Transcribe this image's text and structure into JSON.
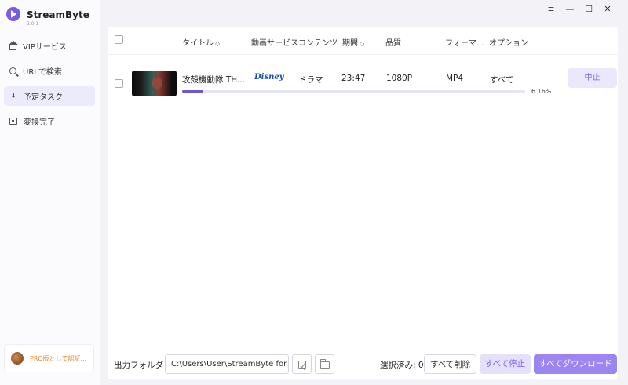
{
  "app": {
    "name": "StreamByte",
    "version": "2.0.1",
    "accent_color": "#7a5be6"
  },
  "sidebar": {
    "items": [
      {
        "label": "VIPサービス",
        "icon": "home-icon",
        "active": false
      },
      {
        "label": "URLで検索",
        "icon": "search-icon",
        "active": false
      },
      {
        "label": "予定タスク",
        "icon": "download-icon",
        "active": true
      },
      {
        "label": "変換完了",
        "icon": "archive-icon",
        "active": false
      }
    ],
    "pro_text": "PRO版として認証..."
  },
  "window_controls": {
    "menu": "≡",
    "minimize": "—",
    "maximize": "☐",
    "close": "✕"
  },
  "table": {
    "columns": {
      "title": "タイトル",
      "service": "動画サービス",
      "content": "コンテンツ",
      "duration": "期間",
      "quality": "品質",
      "format": "フォーマ...",
      "options": "オプション"
    },
    "rows": [
      {
        "title": "攻殻機動隊 TH...",
        "service": "Disney",
        "content": "ドラマ",
        "duration": "23:47",
        "quality": "1080P",
        "format": "MP4",
        "options": "すべて",
        "progress_pct": "6.16%",
        "progress_value": 0.0616,
        "action": "中止"
      }
    ]
  },
  "bottom": {
    "output_label": "出力フォルダ",
    "output_path": "C:\\Users\\User\\StreamByte for",
    "selected": "選択済み: 0",
    "delete_all": "すべて削除",
    "stop_all": "すべて停止",
    "download_all": "すべてダウンロード"
  }
}
